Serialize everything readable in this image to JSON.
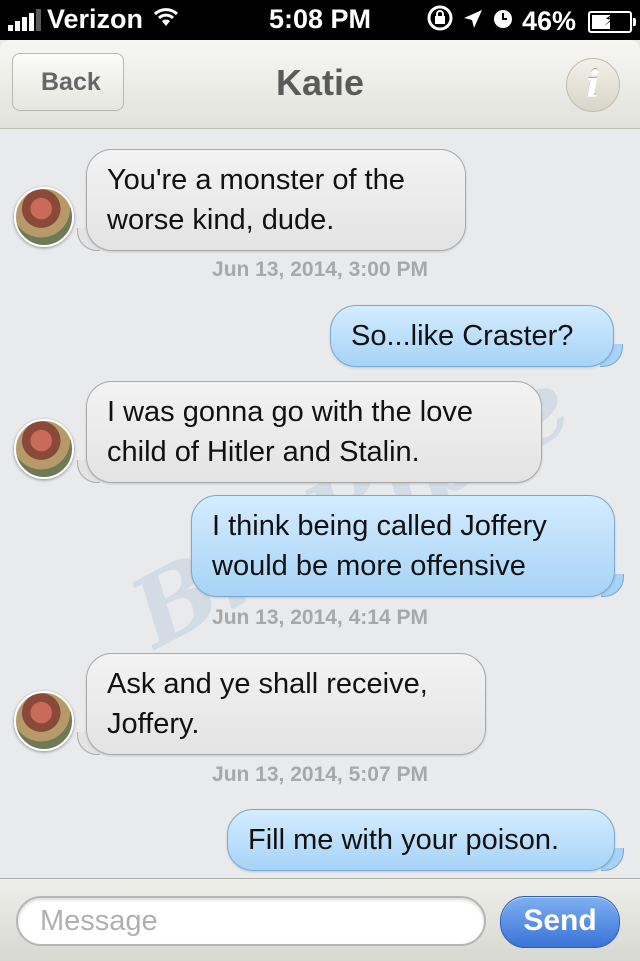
{
  "status_bar": {
    "carrier": "Verizon",
    "time": "5:08 PM",
    "battery": "46%",
    "battery_level": 0.46,
    "icons": [
      "signal-icon",
      "wifi-icon",
      "rotation-lock-icon",
      "location-icon",
      "alarm-icon",
      "battery-icon"
    ]
  },
  "nav": {
    "back_label": "Back",
    "title": "Katie",
    "info_glyph": "i"
  },
  "conversation": [
    {
      "type": "incoming",
      "text": "You're a monster of the worse kind, dude."
    },
    {
      "type": "timestamp",
      "text": "Jun 13, 2014, 3:00 PM"
    },
    {
      "type": "outgoing",
      "text": "So...like Craster?"
    },
    {
      "type": "incoming",
      "text": "I was gonna go with the love child of Hitler and Stalin."
    },
    {
      "type": "outgoing",
      "text": "I think being called Joffery would be more offensive"
    },
    {
      "type": "timestamp",
      "text": "Jun 13, 2014, 4:14 PM"
    },
    {
      "type": "incoming",
      "text": "Ask and ye shall receive, Joffery."
    },
    {
      "type": "timestamp",
      "text": "Jun 13, 2014, 5:07 PM"
    },
    {
      "type": "outgoing",
      "text": "Fill me with your poison."
    }
  ],
  "compose": {
    "placeholder": "Message",
    "value": "",
    "send_label": "Send"
  },
  "watermark": "BroBible",
  "colors": {
    "incoming_bubble": "#e3e3e3",
    "outgoing_bubble": "#a6d3f7",
    "send_button": "#3a73d8",
    "timestamp": "#a8a8a8"
  }
}
